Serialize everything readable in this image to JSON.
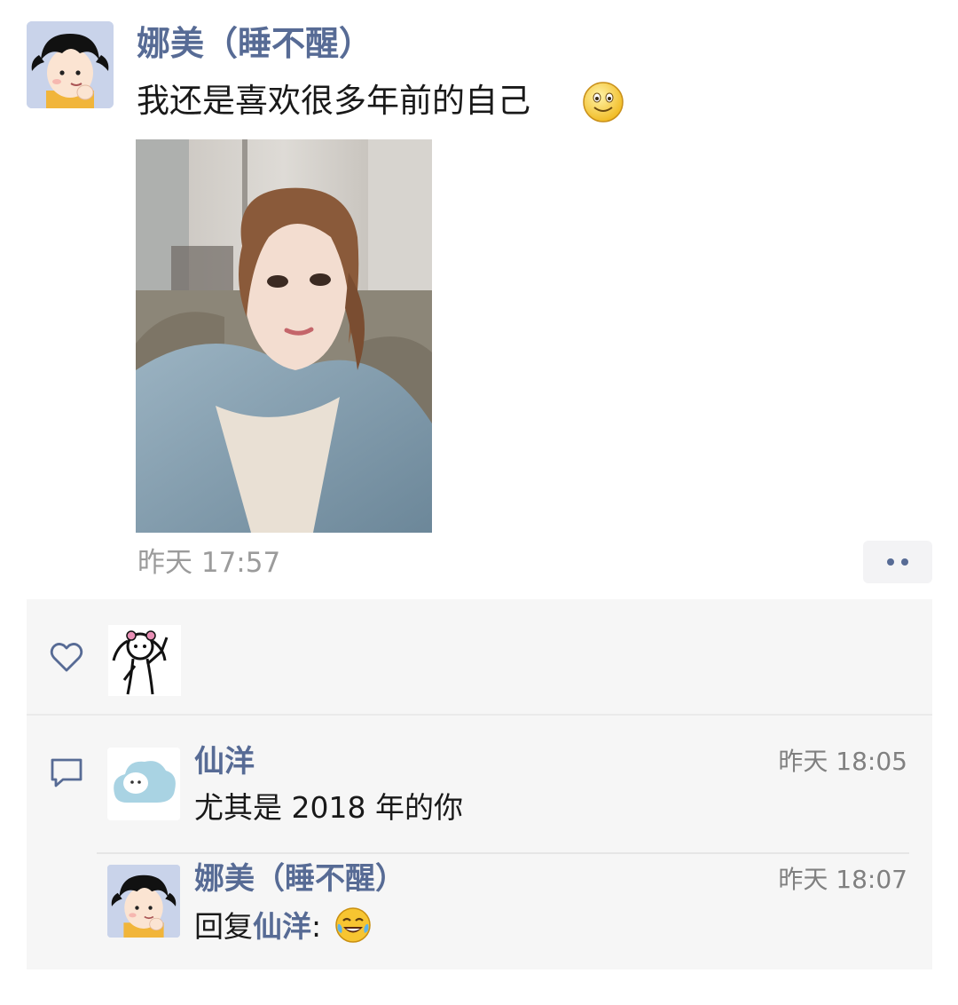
{
  "post": {
    "author": "娜美（睡不醒）",
    "text": "我还是喜欢很多年前的自己",
    "emoji": "smile-emoji",
    "time": "昨天 17:57"
  },
  "likes": {
    "liker_avatar": "doodle-girl-avatar"
  },
  "comments": [
    {
      "author": "仙洋",
      "time": "昨天 18:05",
      "text": "尤其是 2018 年的你"
    },
    {
      "author": "娜美（睡不醒）",
      "time": "昨天 18:07",
      "reply_prefix": "回复",
      "reply_to": "仙洋",
      "colon": ":",
      "emoji": "tears-of-joy-emoji"
    }
  ],
  "colors": {
    "link_blue": "#576b95",
    "meta_gray": "#9b9b9b",
    "panel_bg": "#f6f6f6"
  }
}
